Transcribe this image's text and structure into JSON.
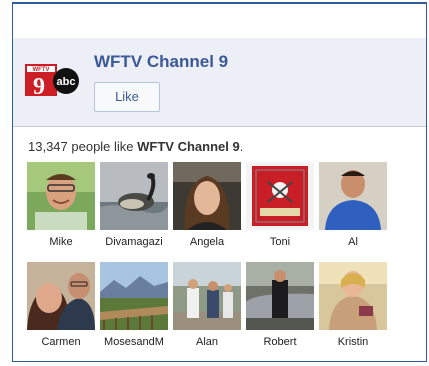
{
  "page": {
    "name": "WFTV Channel 9",
    "like_label": "Like",
    "count_prefix": "13,347 people like ",
    "count_page_name": "WFTV Channel 9",
    "count_suffix": "."
  },
  "logo": {
    "number": "9",
    "network": "abc",
    "wftv_text": "WFTV"
  },
  "colors": {
    "brand_blue": "#3b5998",
    "border_blue": "#315c99",
    "header_bg": "#eceff5",
    "logo_red": "#cc1f25"
  },
  "fans": [
    {
      "name": "Mike",
      "icon": "smiling-man-photo"
    },
    {
      "name": "Divamagazi",
      "icon": "goose-photo"
    },
    {
      "name": "Angela",
      "icon": "woman-photo"
    },
    {
      "name": "Toni",
      "icon": "buccaneers-flag-photo"
    },
    {
      "name": "Al",
      "icon": "man-blue-shirt-photo"
    },
    {
      "name": "Carmen",
      "icon": "couple-photo"
    },
    {
      "name": "MosesandM",
      "icon": "mountain-view-photo"
    },
    {
      "name": "Alan",
      "icon": "people-outdoors-photo"
    },
    {
      "name": "Robert",
      "icon": "man-suit-car-photo"
    },
    {
      "name": "Kristin",
      "icon": "woman-party-photo"
    }
  ]
}
